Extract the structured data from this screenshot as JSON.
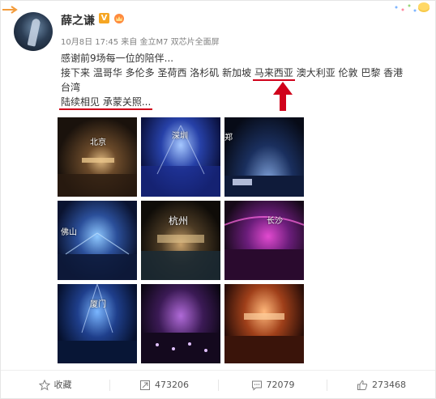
{
  "post": {
    "author_name": "薛之谦",
    "verified_badge": "V",
    "meta": "10月8日 17:45 来自 金立M7 双芯片全面屏",
    "lines": {
      "line1": "感谢前9场每一位的陪伴...",
      "line2_a": "接下来 温哥华 多伦多 圣荷西 洛杉矶 新加坡 ",
      "line2_hl": "马来西亚",
      "line2_b": " 澳大利亚 伦敦 巴黎 香港",
      "line3": "台湾",
      "line4_hl": "陆续相见 承蒙关照..."
    }
  },
  "photos": [
    {
      "city": "北京"
    },
    {
      "city": "深圳"
    },
    {
      "city": "郑"
    },
    {
      "city": "佛山"
    },
    {
      "city": "杭州"
    },
    {
      "city": "长沙"
    },
    {
      "city": "厦门"
    },
    {
      "city": ""
    },
    {
      "city": ""
    }
  ],
  "footer": {
    "favorite_label": "收藏",
    "repost_count": "473206",
    "comment_count": "72079",
    "like_count": "273468"
  },
  "colors": {
    "highlight": "#d0021b",
    "verified": "#f6a623",
    "text": "#333333",
    "meta": "#808080"
  },
  "icons": {
    "favorite": "star-icon",
    "repost": "repost-icon",
    "comment": "comment-icon",
    "like": "thumbs-up-icon",
    "annotation": "red-up-arrow-icon"
  }
}
